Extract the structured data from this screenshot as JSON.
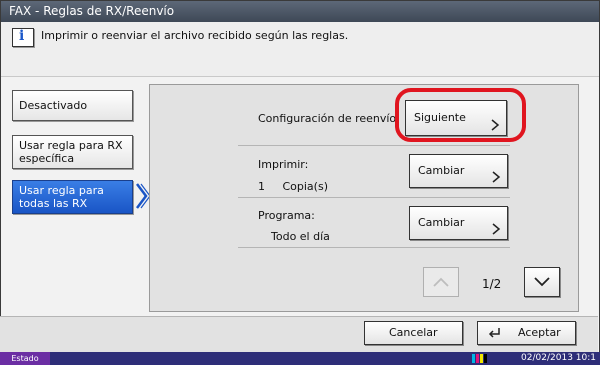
{
  "window": {
    "title": "FAX - Reglas de RX/Reenvío"
  },
  "info": {
    "text": "Imprimir o reenviar el archivo recibido según las reglas.",
    "icon": "info-icon"
  },
  "sidebar": {
    "items": [
      {
        "label": "Desactivado",
        "selected": false
      },
      {
        "label": "Usar regla para RX específica",
        "selected": false
      },
      {
        "label": "Usar regla para todas las RX",
        "selected": true
      }
    ]
  },
  "panel": {
    "forward": {
      "label": "Configuración de reenvío:",
      "button": "Siguiente"
    },
    "print": {
      "label": "Imprimir:",
      "value": "1     Copia(s)",
      "button": "Cambiar"
    },
    "program": {
      "label": "Programa:",
      "value": "Todo el día",
      "button": "Cambiar"
    },
    "pagination": {
      "current_page": "1/2"
    }
  },
  "footer": {
    "cancel": "Cancelar",
    "accept": "Aceptar"
  },
  "status": {
    "label": "Estado",
    "datetime": "02/02/2013  10:1"
  },
  "colors": {
    "highlight": "#e0151f",
    "selected": "#1a55c6",
    "status_bar": "#2e2e78"
  }
}
